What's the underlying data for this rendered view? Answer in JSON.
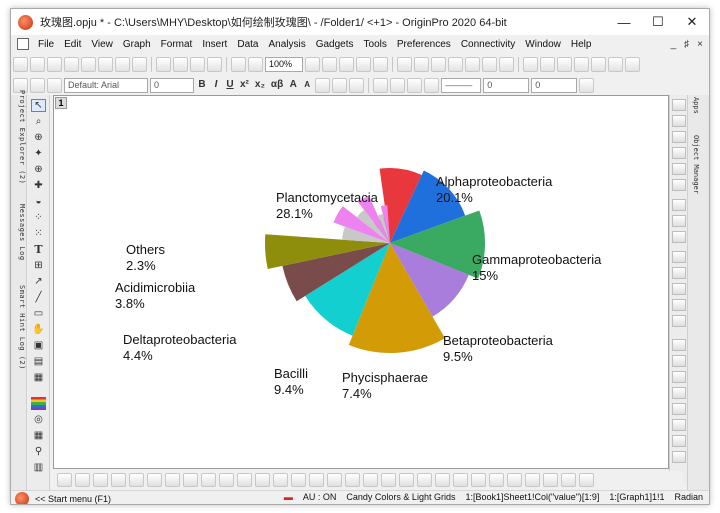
{
  "window": {
    "title": "玫瑰图.opju * - C:\\Users\\MHY\\Desktop\\如何绘制玫瑰图\\ - /Folder1/ <+1> - OriginPro 2020 64-bit",
    "controls": {
      "minimize": "—",
      "maximize": "☐",
      "close": "✕"
    }
  },
  "menubar": {
    "items": [
      "File",
      "Edit",
      "View",
      "Graph",
      "Format",
      "Insert",
      "Data",
      "Analysis",
      "Gadgets",
      "Tools",
      "Preferences",
      "Connectivity",
      "Window",
      "Help"
    ],
    "mdi_controls": [
      "_",
      "♯",
      "×"
    ]
  },
  "toolbar_standard": {
    "zoom": "100%"
  },
  "toolbar_format": {
    "font_name": "Default: Arial",
    "font_size": "0",
    "bold": "B",
    "italic": "I",
    "underline": "U",
    "superscript": "x²",
    "subscript": "x₂",
    "greek": "αβ",
    "grow_font": "A",
    "shrink_font": "A",
    "line_width": "0",
    "pattern_width": "0"
  },
  "left_panel_tabs": [
    "Project Explorer (2)",
    "Messages Log",
    "Smart Hint Log (2)"
  ],
  "right_panel_tabs": [
    "Apps",
    "Object Manager"
  ],
  "graph": {
    "layer_label": "1"
  },
  "left_tools": {
    "text_tool": "T"
  },
  "statusbar": {
    "start_menu": "<< Start menu (F1)",
    "au": "AU : ON",
    "theme": "Candy Colors & Light Grids",
    "active_col": "1:[Book1]Sheet1!Col(\"value\")[1:9]",
    "active_graph": "1:[Graph1]1!1",
    "angle_unit": "Radian"
  },
  "chart_data": {
    "type": "pie",
    "variant": "rose",
    "legend": "none",
    "slices": [
      {
        "name": "Alphaproteobacteria",
        "percent": "20.1%",
        "value": 20.1,
        "color": "#e8383d"
      },
      {
        "name": "Gammaproteobacteria",
        "percent": "15%",
        "value": 15.0,
        "color": "#1f6fdc"
      },
      {
        "name": "Betaproteobacteria",
        "percent": "9.5%",
        "value": 9.5,
        "color": "#3aaa62"
      },
      {
        "name": "Phycisphaerae",
        "percent": "7.4%",
        "value": 7.4,
        "color": "#a87ddb"
      },
      {
        "name": "Bacilli",
        "percent": "9.4%",
        "value": 9.4,
        "color": "#d39b05"
      },
      {
        "name": "Deltaproteobacteria",
        "percent": "4.4%",
        "value": 4.4,
        "color": "#14cfcf"
      },
      {
        "name": "Acidimicrobiia",
        "percent": "3.8%",
        "value": 3.8,
        "color": "#7a4b4b"
      },
      {
        "name": "Others",
        "percent": "2.3%",
        "value": 2.3,
        "color": "#8e8e0c"
      },
      {
        "name": "Planctomycetacia",
        "percent": "28.1%",
        "value": 28.1,
        "color": "#4b4b4b"
      }
    ],
    "inner_wedges": [
      {
        "value": 1.4,
        "color": "#c8c8c8"
      },
      {
        "value": 1.6,
        "color": "#ee82ee"
      },
      {
        "value": 1.3,
        "color": "#c8c8c8"
      },
      {
        "value": 1.5,
        "color": "#ee82ee"
      },
      {
        "value": 1.1,
        "color": "#c8c8c8"
      },
      {
        "value": 1.3,
        "color": "#ee82ee"
      }
    ]
  }
}
